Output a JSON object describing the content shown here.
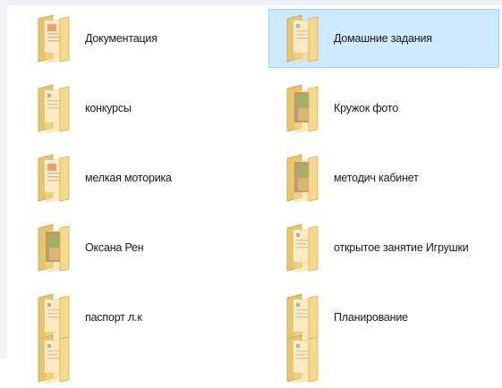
{
  "folders": [
    {
      "label": "Документация",
      "preview": "doc",
      "selected": false
    },
    {
      "label": "Домашние задания",
      "preview": "plain",
      "selected": true
    },
    {
      "label": "конкурсы",
      "preview": "plain",
      "selected": false
    },
    {
      "label": "Кружок фото",
      "preview": "photo",
      "selected": false
    },
    {
      "label": "мелкая моторика",
      "preview": "doc",
      "selected": false
    },
    {
      "label": "методич кабинет",
      "preview": "photo",
      "selected": false
    },
    {
      "label": "Оксана Рен",
      "preview": "photo",
      "selected": false
    },
    {
      "label": "открытое занятие Игрушки",
      "preview": "plain",
      "selected": false
    },
    {
      "label": "паспорт л.к",
      "preview": "plain",
      "selected": false
    },
    {
      "label": "Планирование",
      "preview": "plain",
      "selected": false
    }
  ],
  "colors": {
    "selection_bg": "#cde8ff",
    "selection_border": "#99d1ff",
    "folder_back": "#e8c56a",
    "folder_front": "#f7d98b"
  }
}
